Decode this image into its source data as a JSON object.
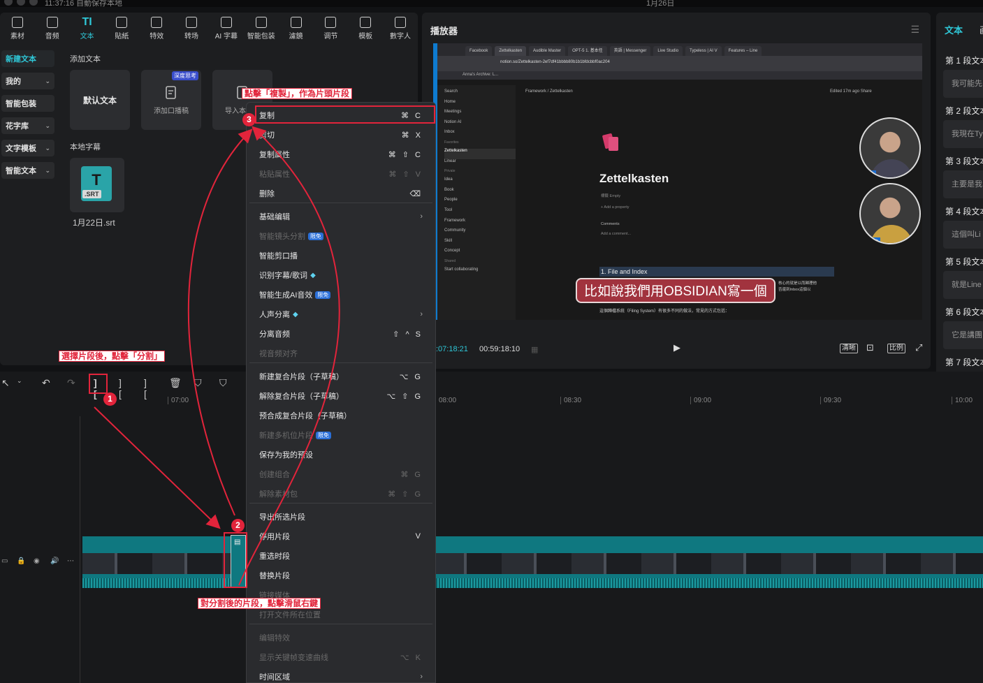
{
  "system": {
    "left_text": "11:37:16 自動保存本地",
    "date": "1月26日"
  },
  "tabs": [
    {
      "label": "素材",
      "icon": "media-icon"
    },
    {
      "label": "音频",
      "icon": "audio-icon"
    },
    {
      "label": "文本",
      "icon": "text-icon",
      "glyph": "TI"
    },
    {
      "label": "貼紙",
      "icon": "sticker-icon"
    },
    {
      "label": "特效",
      "icon": "effects-icon"
    },
    {
      "label": "转场",
      "icon": "transition-icon"
    },
    {
      "label": "AI 字幕",
      "icon": "ai-caption-icon"
    },
    {
      "label": "智能包装",
      "icon": "smart-pack-icon"
    },
    {
      "label": "濾鏡",
      "icon": "filter-icon"
    },
    {
      "label": "调节",
      "icon": "adjust-icon"
    },
    {
      "label": "模板",
      "icon": "template-icon"
    },
    {
      "label": "數字人",
      "icon": "avatar-icon"
    }
  ],
  "sidebar": [
    {
      "label": "新建文本",
      "active": true
    },
    {
      "label": "我的"
    },
    {
      "label": "智能包装"
    },
    {
      "label": "花字库"
    },
    {
      "label": "文字模板"
    },
    {
      "label": "智能文本"
    }
  ],
  "media": {
    "add_text_title": "添加文本",
    "default_text": "默认文本",
    "add_script_badge": "深度思考",
    "add_script": "添加口播稿",
    "import_script": "导入本",
    "local_subs_title": "本地字幕",
    "srt_label": ".SRT",
    "srt_glyph": "T",
    "srt_file": "1月22日.srt"
  },
  "player": {
    "title": "播放器",
    "browser_tabs": [
      "Facebook",
      "Zettelkasten",
      "Audible Master",
      "OPT-5 1. 基本任",
      "英語 | Messenger",
      "Live Studio",
      "Typeless | AI V",
      "Features – Line"
    ],
    "url": "notion.so/Zettelkasten-2ef7df41bbbb80b1b1bfdcbbf0ac204",
    "bookmark": "Anna's Archive: L...",
    "notion_sidebar": [
      "Search",
      "Home",
      "Meetings",
      "Notion AI",
      "Inbox",
      "Favorites",
      "Zettelkasten",
      "Linear",
      "Private",
      "Idea",
      "Book",
      "People",
      "Tool",
      "Framework",
      "Community",
      "Skill",
      "Concept",
      "Shared",
      "Start collaborating"
    ],
    "breadcrumb": "Framework  /  Zettelkasten",
    "edited": "Edited 17m ago   Share",
    "page_title": "Zettelkasten",
    "prop1": "標籤        Empty",
    "prop2": "+ Add a property",
    "comments": "Comments",
    "add_comment": "Add a comment...",
    "heading": "1. File and Index",
    "body1": "核心的就是以而歸理他",
    "body2": "否還到Inbox這個以",
    "body3": "這個歸檔系統（Filing System）有很多不同的做法，常見的方式包括：",
    "subtitle": "比如說我們用OBSIDIAN寫一個",
    "cam1_name": "朱凱",
    "cam2_name": "王詠峰",
    "time_current": ":07:18:21",
    "time_total": "00:59:18:10",
    "btn_clear": "清晰",
    "btn_ratio": "比例"
  },
  "text_panel": {
    "tab": "文本",
    "tab2": "画",
    "segments": [
      {
        "title": "第 1 段文本",
        "body": "我可能先"
      },
      {
        "title": "第 2 段文本",
        "body": "我現在Ty"
      },
      {
        "title": "第 3 段文本",
        "body": "主要是我"
      },
      {
        "title": "第 4 段文本",
        "body": "這個叫Li"
      },
      {
        "title": "第 5 段文本",
        "body": "就是Line"
      },
      {
        "title": "第 6 段文本",
        "body": "它是講團"
      },
      {
        "title": "第 7 段文本",
        "body": ""
      }
    ]
  },
  "timeline": {
    "ruler": [
      "07:00",
      "08:00",
      "08:30",
      "09:00",
      "09:30",
      "10:00"
    ]
  },
  "context_menu": [
    {
      "label": "复制",
      "shortcut": "⌘ C",
      "highlight": true
    },
    {
      "label": "剪切",
      "shortcut": "⌘ X"
    },
    {
      "label": "复制属性",
      "shortcut": "⌘ ⇧ C"
    },
    {
      "label": "粘贴属性",
      "shortcut": "⌘ ⇧ V",
      "disabled": true
    },
    {
      "label": "删除",
      "shortcut": "⌫"
    },
    {
      "label": "基础编辑",
      "arrow": true
    },
    {
      "label": "智能镜头分割",
      "tag": "限免",
      "disabled": true
    },
    {
      "label": "智能剪口播"
    },
    {
      "label": "识别字幕/歌词",
      "gem": true
    },
    {
      "label": "智能生成AI音效",
      "tag": "限免"
    },
    {
      "label": "人声分离",
      "gem": true,
      "arrow": true
    },
    {
      "label": "分离音频",
      "shortcut": "⇧ ^ S"
    },
    {
      "label": "视音频对齐",
      "disabled": true
    },
    {
      "label": "新建复合片段（子草稿）",
      "shortcut": "⌥ G"
    },
    {
      "label": "解除复合片段（子草稿）",
      "shortcut": "⌥ ⇧ G"
    },
    {
      "label": "预合成复合片段（子草稿）"
    },
    {
      "label": "新建多机位片段",
      "tag": "限免",
      "disabled": true
    },
    {
      "label": "保存为我的预设"
    },
    {
      "label": "创建组合",
      "shortcut": "⌘ G",
      "disabled": true
    },
    {
      "label": "解除素材包",
      "shortcut": "⌘ ⇧ G",
      "disabled": true
    },
    {
      "label": "导出所选片段"
    },
    {
      "label": "停用片段",
      "shortcut": "V"
    },
    {
      "label": "重选时段"
    },
    {
      "label": "替换片段"
    },
    {
      "label": "链接媒体",
      "disabled": true
    },
    {
      "label": "打开文件所在位置",
      "disabled": true
    },
    {
      "label": "编辑特效",
      "disabled": true
    },
    {
      "label": "显示关键帧变速曲线",
      "shortcut": "⌥ K",
      "disabled": true
    },
    {
      "label": "时间区域",
      "arrow": true
    }
  ],
  "annotations": {
    "a1": "選擇片段後，點擊「分割」",
    "a2": "對分割後的片段，點擊滑鼠右鍵",
    "a3": "點擊「複製」，作為片頭片段",
    "n1": "1",
    "n2": "2",
    "n3": "3"
  },
  "colors": {
    "accent": "#2fc8d8",
    "annotation": "#e2243b",
    "track": "#0f7880"
  }
}
